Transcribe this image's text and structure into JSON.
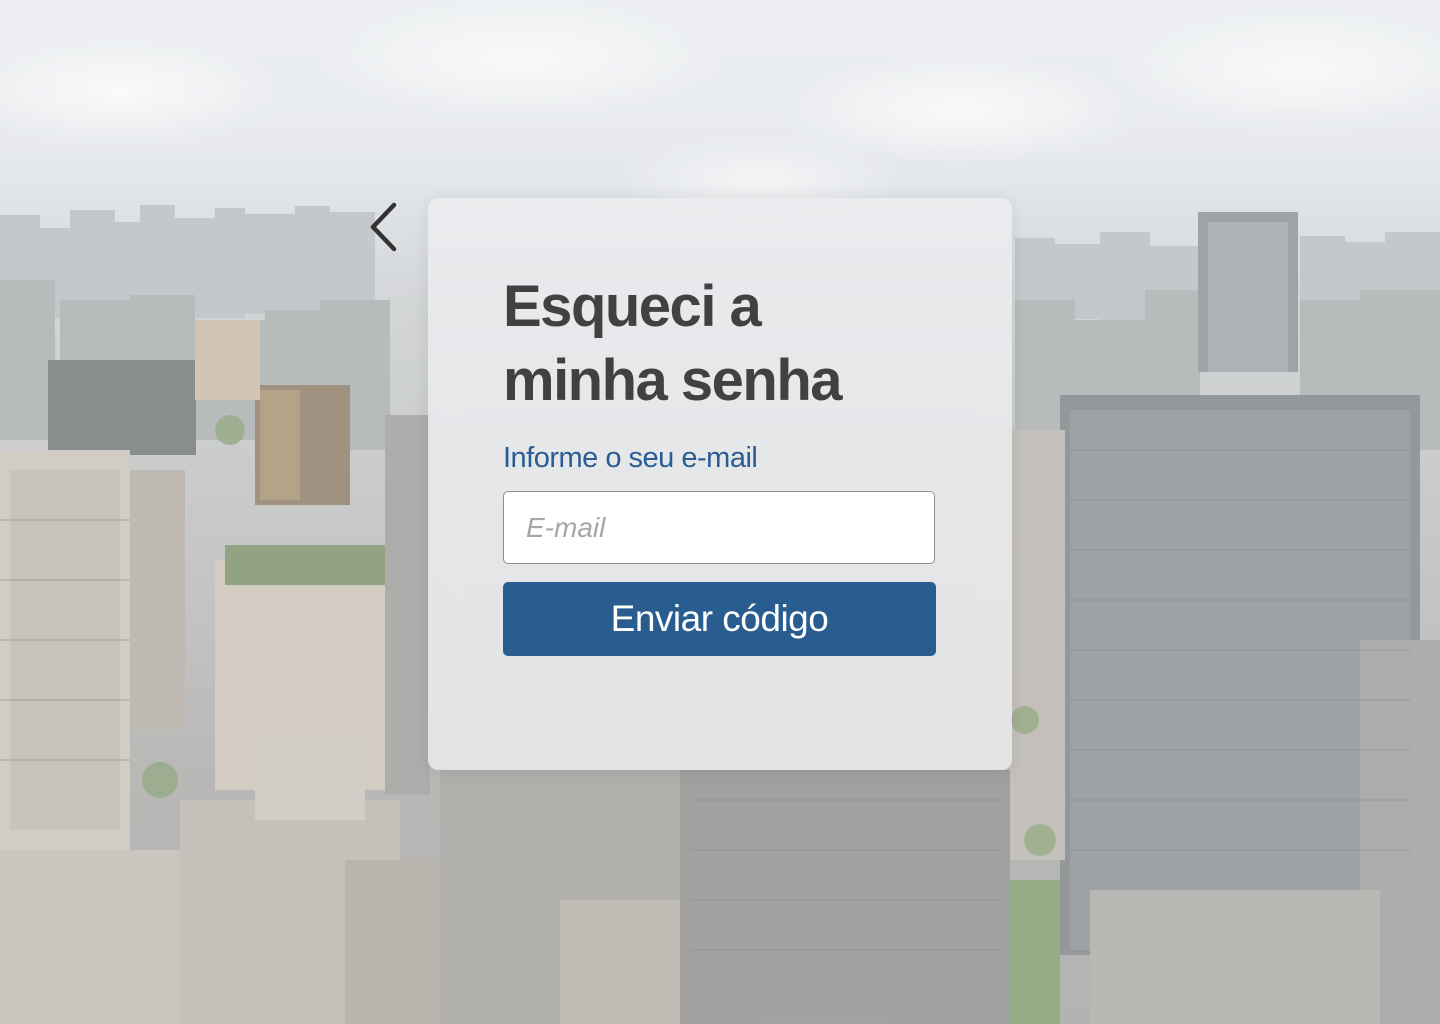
{
  "page": {
    "title_line_1": "Esqueci a",
    "title_line_2": "minha senha",
    "email_label": "Informe o seu e-mail",
    "email_placeholder": "E-mail",
    "email_value": "",
    "submit_label": "Enviar código"
  },
  "icons": {
    "back": "chevron-left-icon"
  },
  "colors": {
    "accent": "#2a5d8f",
    "label": "#2a5d93",
    "title": "#414141"
  }
}
